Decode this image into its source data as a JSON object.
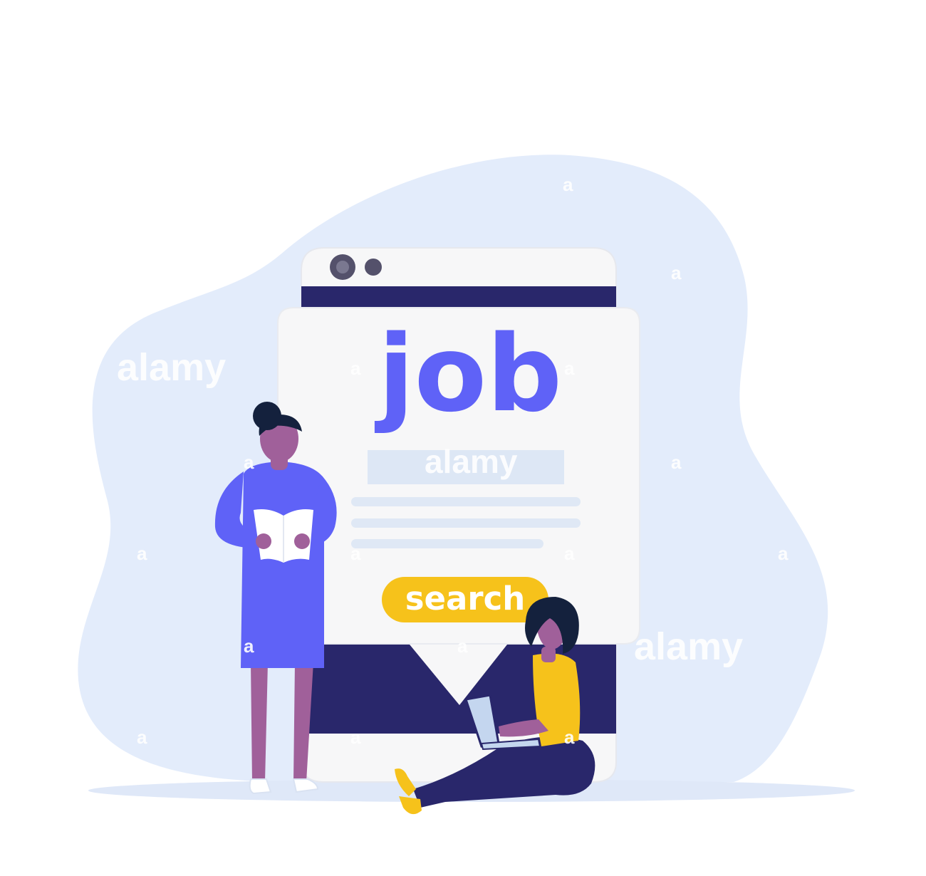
{
  "hero": {
    "title": "job",
    "search_button_label": "search"
  },
  "watermark": {
    "brand": "alamy",
    "mark": "a"
  },
  "colors": {
    "blob": "#e3ecfb",
    "floor_shadow": "#dfe8f8",
    "panel": "#f7f7f8",
    "panel_border": "#e6e8ee",
    "navy": "#29276b",
    "accent_blue": "#5f62f7",
    "search_yellow": "#f6c21b",
    "input_bar": "#dde7f5",
    "text_lines": "#dfe8f5",
    "skin": "#a0609a",
    "hair": "#14213d",
    "laptop": "#c4d6ef",
    "dot_dark": "#54516b",
    "dot_inner": "#7a7890"
  }
}
